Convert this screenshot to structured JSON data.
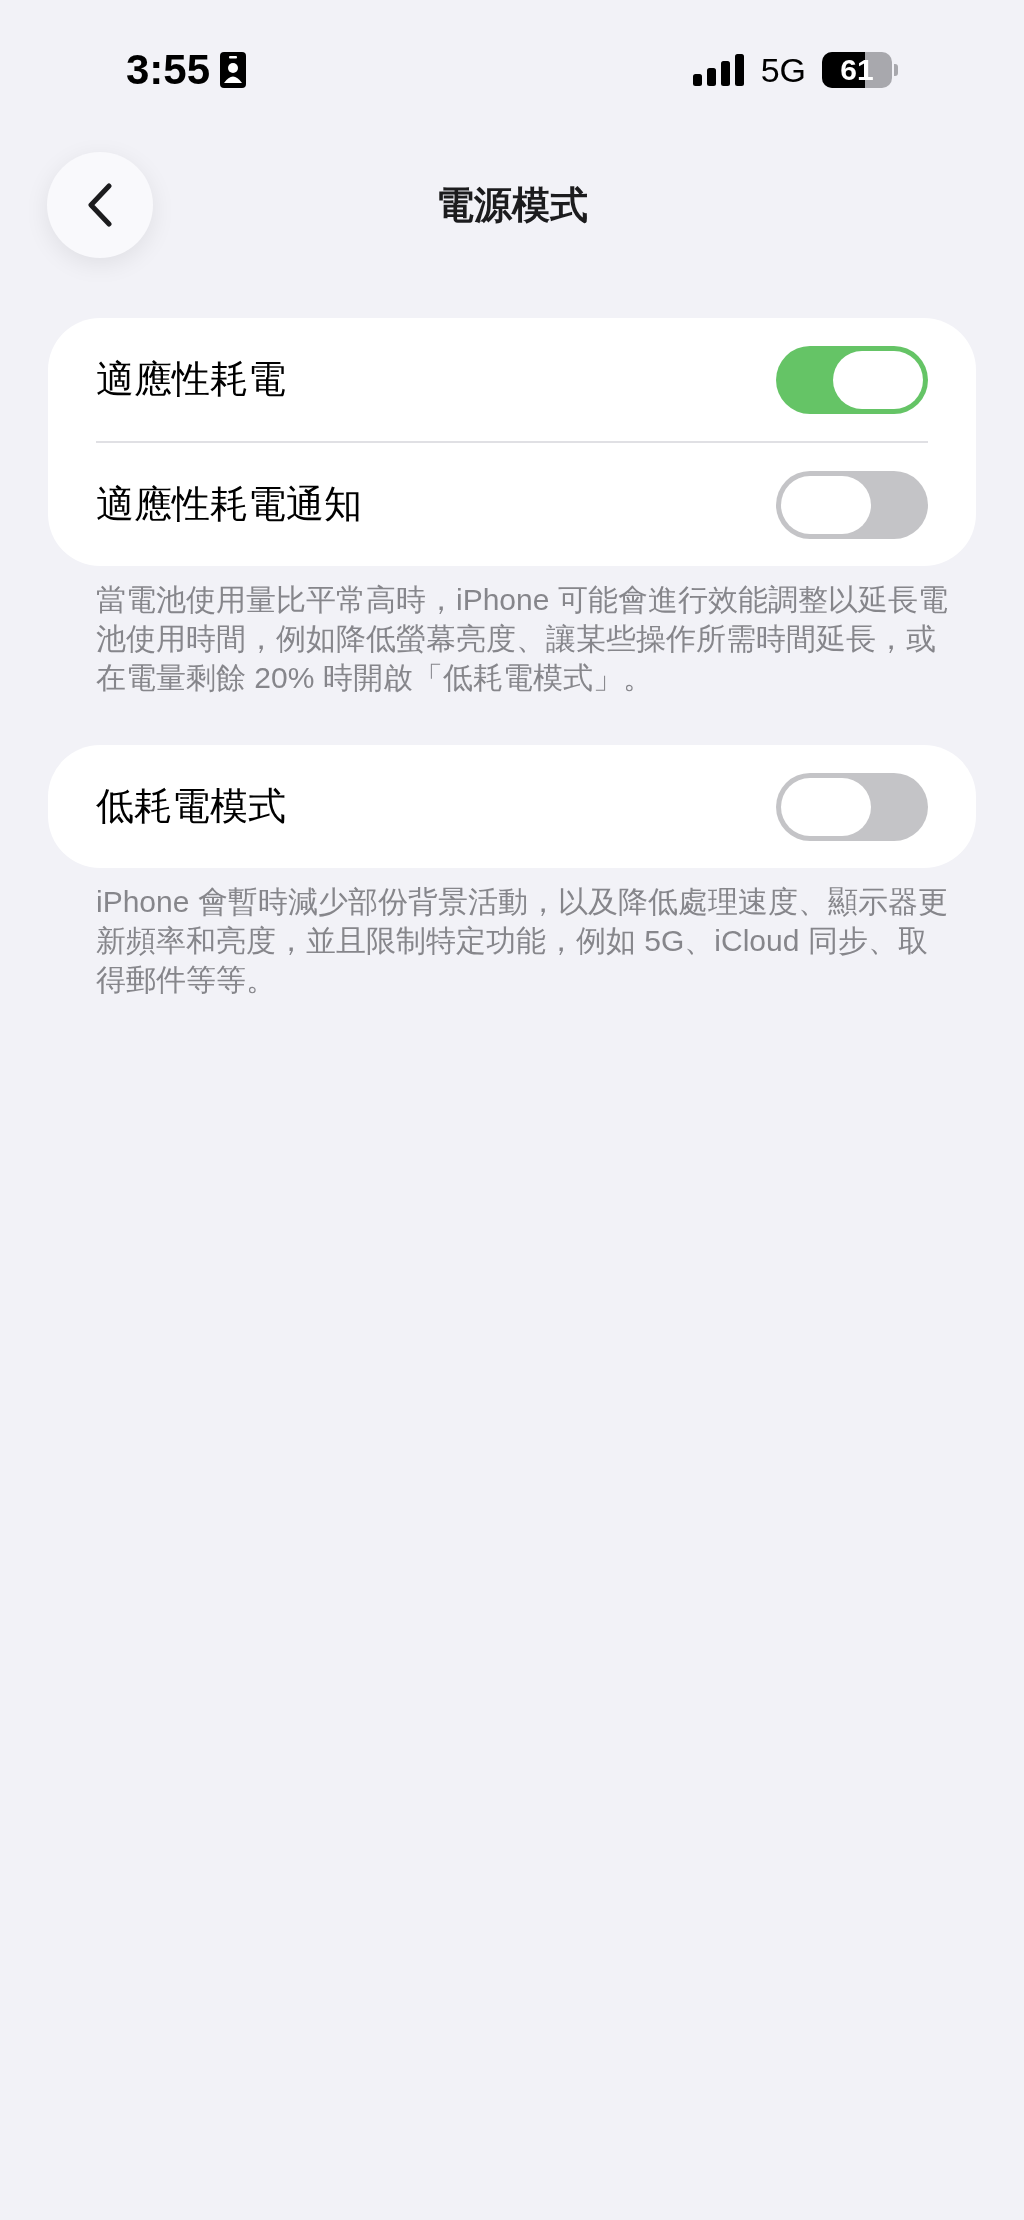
{
  "status_bar": {
    "time": "3:55",
    "network": "5G",
    "battery": "61"
  },
  "nav": {
    "title": "電源模式"
  },
  "sections": [
    {
      "rows": [
        {
          "label": "適應性耗電",
          "on": true
        },
        {
          "label": "適應性耗電通知",
          "on": false
        }
      ],
      "footer": "當電池使用量比平常高時，iPhone 可能會進行效能調整以延長電池使用時間，例如降低螢幕亮度、讓某些操作所需時間延長，或在電量剩餘 20% 時開啟「低耗電模式」。"
    },
    {
      "rows": [
        {
          "label": "低耗電模式",
          "on": false
        }
      ],
      "footer": "iPhone 會暫時減少部份背景活動，以及降低處理速度、顯示器更新頻率和亮度，並且限制特定功能，例如 5G、iCloud 同步、取得郵件等等。"
    }
  ]
}
